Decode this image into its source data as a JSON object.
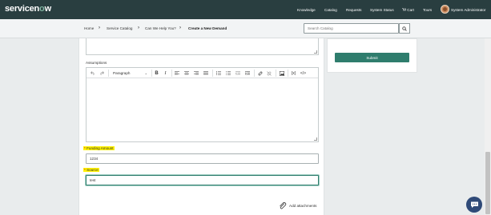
{
  "header": {
    "logo_prefix": "servicen",
    "logo_o": "o",
    "logo_suffix": "w",
    "nav": [
      "Knowledge",
      "Catalog",
      "Requests",
      "System Status",
      "Cart",
      "Tours"
    ],
    "user": "System Administrator",
    "background": "#293e40"
  },
  "breadcrumb": {
    "items": [
      "Home",
      "Service Catalog",
      "Can We Help You?",
      "Create a New Demand"
    ]
  },
  "search": {
    "placeholder": "Search Catalog",
    "value": ""
  },
  "form": {
    "assumptions_label": "Assumptions",
    "editor": {
      "format_value": "Paragraph",
      "tools": [
        "undo-icon",
        "redo-icon",
        "bold-icon",
        "italic-icon",
        "align-left-icon",
        "align-center-icon",
        "align-right-icon",
        "align-justify-icon",
        "bullet-list-icon",
        "numbered-list-icon",
        "outdent-icon",
        "indent-icon",
        "link-icon",
        "unlink-icon",
        "image-icon",
        "variable-icon",
        "code-icon"
      ],
      "bold": "B",
      "italic": "I"
    },
    "funding_required": "*",
    "funding_label": "Funding Amount",
    "funding_value": "1234",
    "source_required": "*",
    "source_label": "Source",
    "source_value": "test",
    "highlight_color": "#fff200"
  },
  "sidebar": {
    "submit_label": "Submit",
    "accent": "#2f7d6d"
  },
  "attachments": {
    "label": "Add attachments"
  }
}
